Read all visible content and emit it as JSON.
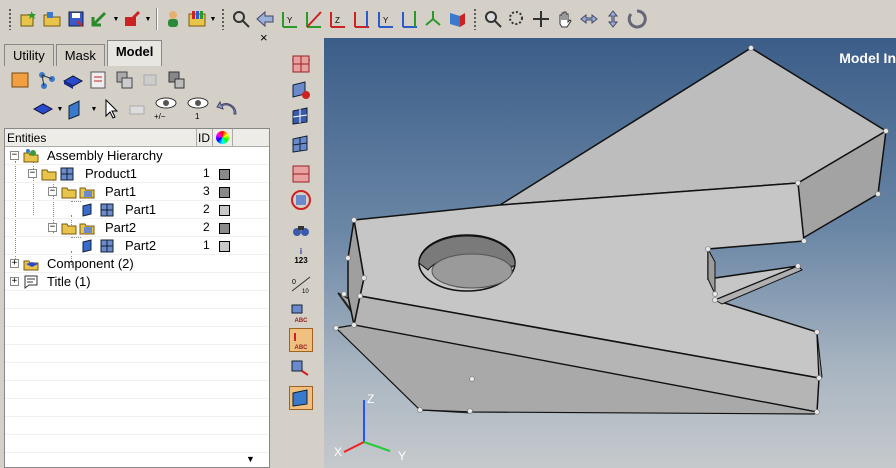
{
  "tabs": [
    {
      "label": "Utility",
      "active": false
    },
    {
      "label": "Mask",
      "active": false
    },
    {
      "label": "Model",
      "active": true
    }
  ],
  "panel_close": "×",
  "eye_labels": {
    "plus_minus": "+/−",
    "one": "1"
  },
  "entities": {
    "header": {
      "name": "Entities",
      "id": "ID"
    },
    "rows": [
      {
        "label": "Assembly Hierarchy",
        "id": "",
        "color": "",
        "expander": "−"
      },
      {
        "label": "Product1",
        "id": "1",
        "color": "#8a8a8a",
        "expander": "−"
      },
      {
        "label": "Part1",
        "id": "3",
        "color": "#8a8a8a",
        "expander": "−"
      },
      {
        "label": "Part1",
        "id": "2",
        "color": "#c8c8c8",
        "expander": ""
      },
      {
        "label": "Part2",
        "id": "2",
        "color": "#8a8a8a",
        "expander": "−"
      },
      {
        "label": "Part2",
        "id": "1",
        "color": "#c8c8c8",
        "expander": ""
      },
      {
        "label": "Component (2)",
        "id": "",
        "color": "",
        "expander": "+"
      },
      {
        "label": "Title (1)",
        "id": "",
        "color": "",
        "expander": "+"
      }
    ]
  },
  "viewport": {
    "model_info": "Model In",
    "triad": {
      "x": "X",
      "y": "Y",
      "z": "Z"
    }
  },
  "vtoolbar_text": {
    "abc": "ABC",
    "num": "123",
    "info": "i"
  },
  "colors": {
    "viewport_top": "#3b5d88",
    "viewport_bottom": "#c5c9cc",
    "part_face": "#c9c9c9",
    "part_side": "#a9a9a9",
    "accent": "#f0c080"
  }
}
